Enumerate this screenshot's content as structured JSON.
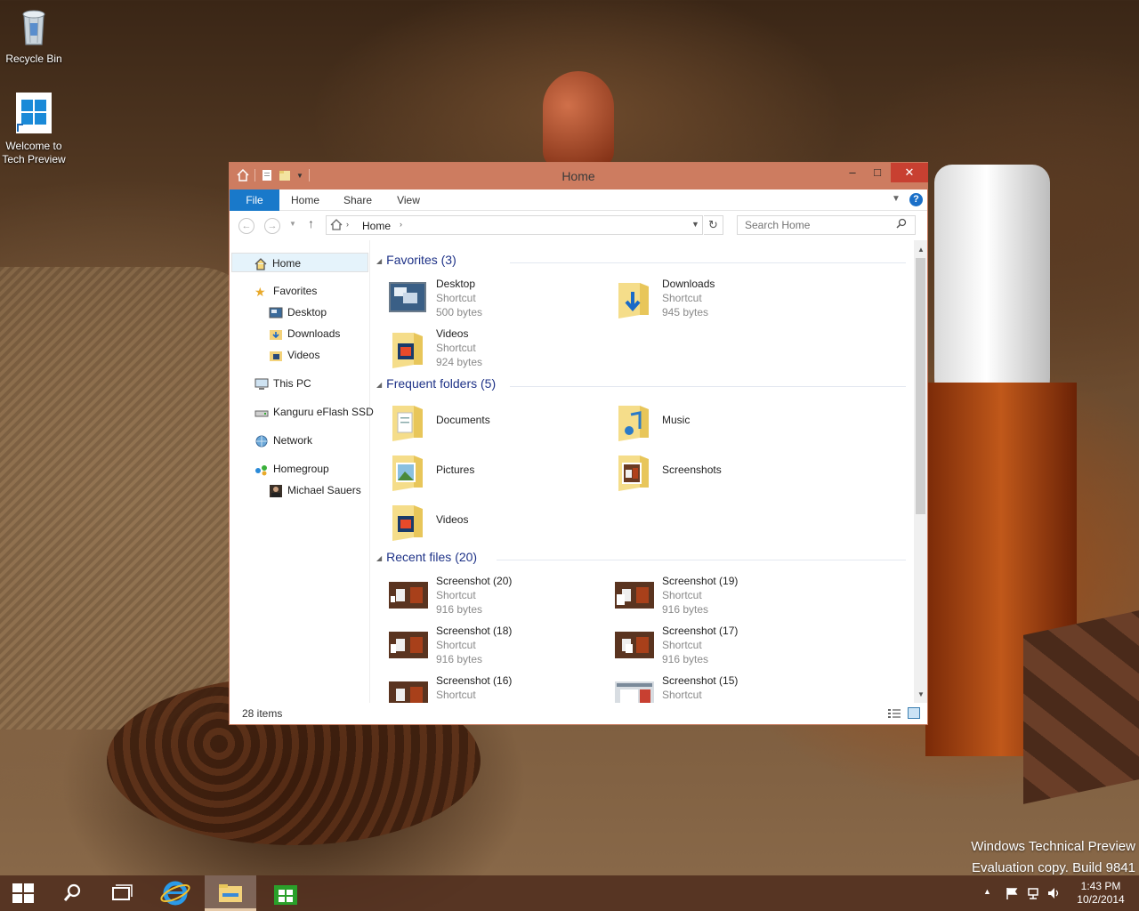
{
  "desktop": {
    "icons": [
      {
        "label": "Recycle Bin",
        "icon": "recycle-bin-icon"
      },
      {
        "label": "Welcome to Tech Preview",
        "icon": "windows-logo-icon"
      }
    ],
    "watermark": {
      "line1": "Windows Technical Preview",
      "line2": "Evaluation copy. Build 9841"
    }
  },
  "window": {
    "title": "Home",
    "controls": {
      "minimize": "–",
      "maximize": "□",
      "close": "✕"
    },
    "ribbon_tabs": [
      "File",
      "Home",
      "Share",
      "View"
    ],
    "address": {
      "path": [
        "Home"
      ],
      "separator": "›"
    },
    "search": {
      "placeholder": "Search Home"
    },
    "nav_pane": {
      "items": [
        {
          "label": "Home",
          "icon": "home-icon",
          "level": 0,
          "selected": true
        },
        {
          "label": "Favorites",
          "icon": "star-icon",
          "level": 0
        },
        {
          "label": "Desktop",
          "icon": "desktop-icon",
          "level": 1
        },
        {
          "label": "Downloads",
          "icon": "downloads-folder-icon",
          "level": 1
        },
        {
          "label": "Videos",
          "icon": "videos-folder-icon",
          "level": 1
        },
        {
          "label": "This PC",
          "icon": "computer-icon",
          "level": 0
        },
        {
          "label": "Kanguru eFlash SSD",
          "icon": "drive-icon",
          "level": 0
        },
        {
          "label": "Network",
          "icon": "network-icon",
          "level": 0
        },
        {
          "label": "Homegroup",
          "icon": "homegroup-icon",
          "level": 0
        },
        {
          "label": "Michael Sauers",
          "icon": "user-avatar-icon",
          "level": 1
        }
      ]
    },
    "groups": {
      "favorites": {
        "title": "Favorites (3)",
        "items": [
          {
            "name": "Desktop",
            "type": "Shortcut",
            "size": "500 bytes"
          },
          {
            "name": "Downloads",
            "type": "Shortcut",
            "size": "945 bytes"
          },
          {
            "name": "Videos",
            "type": "Shortcut",
            "size": "924 bytes"
          }
        ]
      },
      "frequent": {
        "title": "Frequent folders (5)",
        "items": [
          {
            "name": "Documents"
          },
          {
            "name": "Music"
          },
          {
            "name": "Pictures"
          },
          {
            "name": "Screenshots"
          },
          {
            "name": "Videos"
          }
        ]
      },
      "recent": {
        "title": "Recent files (20)",
        "items": [
          {
            "name": "Screenshot (20)",
            "type": "Shortcut",
            "size": "916 bytes"
          },
          {
            "name": "Screenshot (19)",
            "type": "Shortcut",
            "size": "916 bytes"
          },
          {
            "name": "Screenshot (18)",
            "type": "Shortcut",
            "size": "916 bytes"
          },
          {
            "name": "Screenshot (17)",
            "type": "Shortcut",
            "size": "916 bytes"
          },
          {
            "name": "Screenshot (16)",
            "type": "Shortcut"
          },
          {
            "name": "Screenshot (15)",
            "type": "Shortcut"
          }
        ]
      }
    },
    "status": {
      "count": "28 items"
    }
  },
  "taskbar": {
    "clock": {
      "time": "1:43 PM",
      "date": "10/2/2014"
    }
  },
  "colors": {
    "titlebar": "#cd7c60",
    "file_tab": "#1979ca",
    "close_button": "#c84031",
    "group_header": "#1e3287",
    "taskbar": "#502d1e"
  }
}
